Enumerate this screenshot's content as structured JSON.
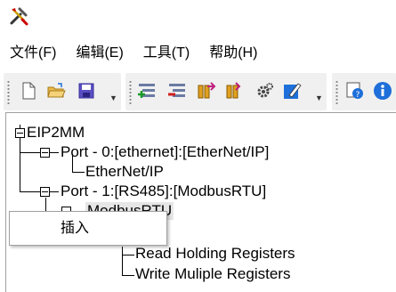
{
  "menu": {
    "items": [
      {
        "label": "文件(F)"
      },
      {
        "label": "编辑(E)"
      },
      {
        "label": "工具(T)"
      },
      {
        "label": "帮助(H)"
      }
    ]
  },
  "toolbar": {
    "icons": [
      "new-file-icon",
      "open-folder-icon",
      "save-icon",
      "add-node-icon",
      "remove-node-icon",
      "import-icon",
      "export-icon",
      "settings-gear-icon",
      "edit-icon",
      "help-icon",
      "info-icon"
    ]
  },
  "tree": {
    "root": "EIP2MM",
    "port0": "Port - 0:[ethernet]:[EtherNet/IP]",
    "port0_child": "EtherNet/IP",
    "port1": "Port - 1:[RS485]:[ModbusRTU]",
    "port1_child": "ModbusRTU",
    "read_holding": "Read Holding Registers",
    "write_multiple": "Write Muliple Registers"
  },
  "context_menu": {
    "insert_label": "插入"
  },
  "colors": {
    "toolbar_bg": "#f0f0f0",
    "accent_blue": "#1e6fd9",
    "selection": "#e6e6e6"
  }
}
